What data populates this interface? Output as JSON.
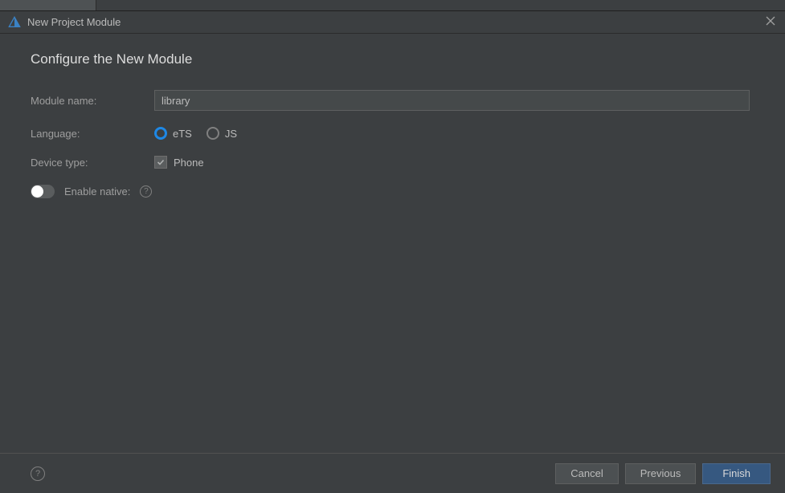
{
  "window": {
    "title": "New Project Module"
  },
  "page": {
    "title": "Configure the New Module"
  },
  "form": {
    "module_name": {
      "label": "Module name:",
      "value": "library"
    },
    "language": {
      "label": "Language:",
      "options": [
        {
          "label": "eTS",
          "selected": true
        },
        {
          "label": "JS",
          "selected": false
        }
      ]
    },
    "device_type": {
      "label": "Device type:",
      "options": [
        {
          "label": "Phone",
          "checked": true
        }
      ]
    },
    "enable_native": {
      "label": "Enable native:",
      "enabled": false
    }
  },
  "footer": {
    "cancel": "Cancel",
    "previous": "Previous",
    "finish": "Finish"
  }
}
